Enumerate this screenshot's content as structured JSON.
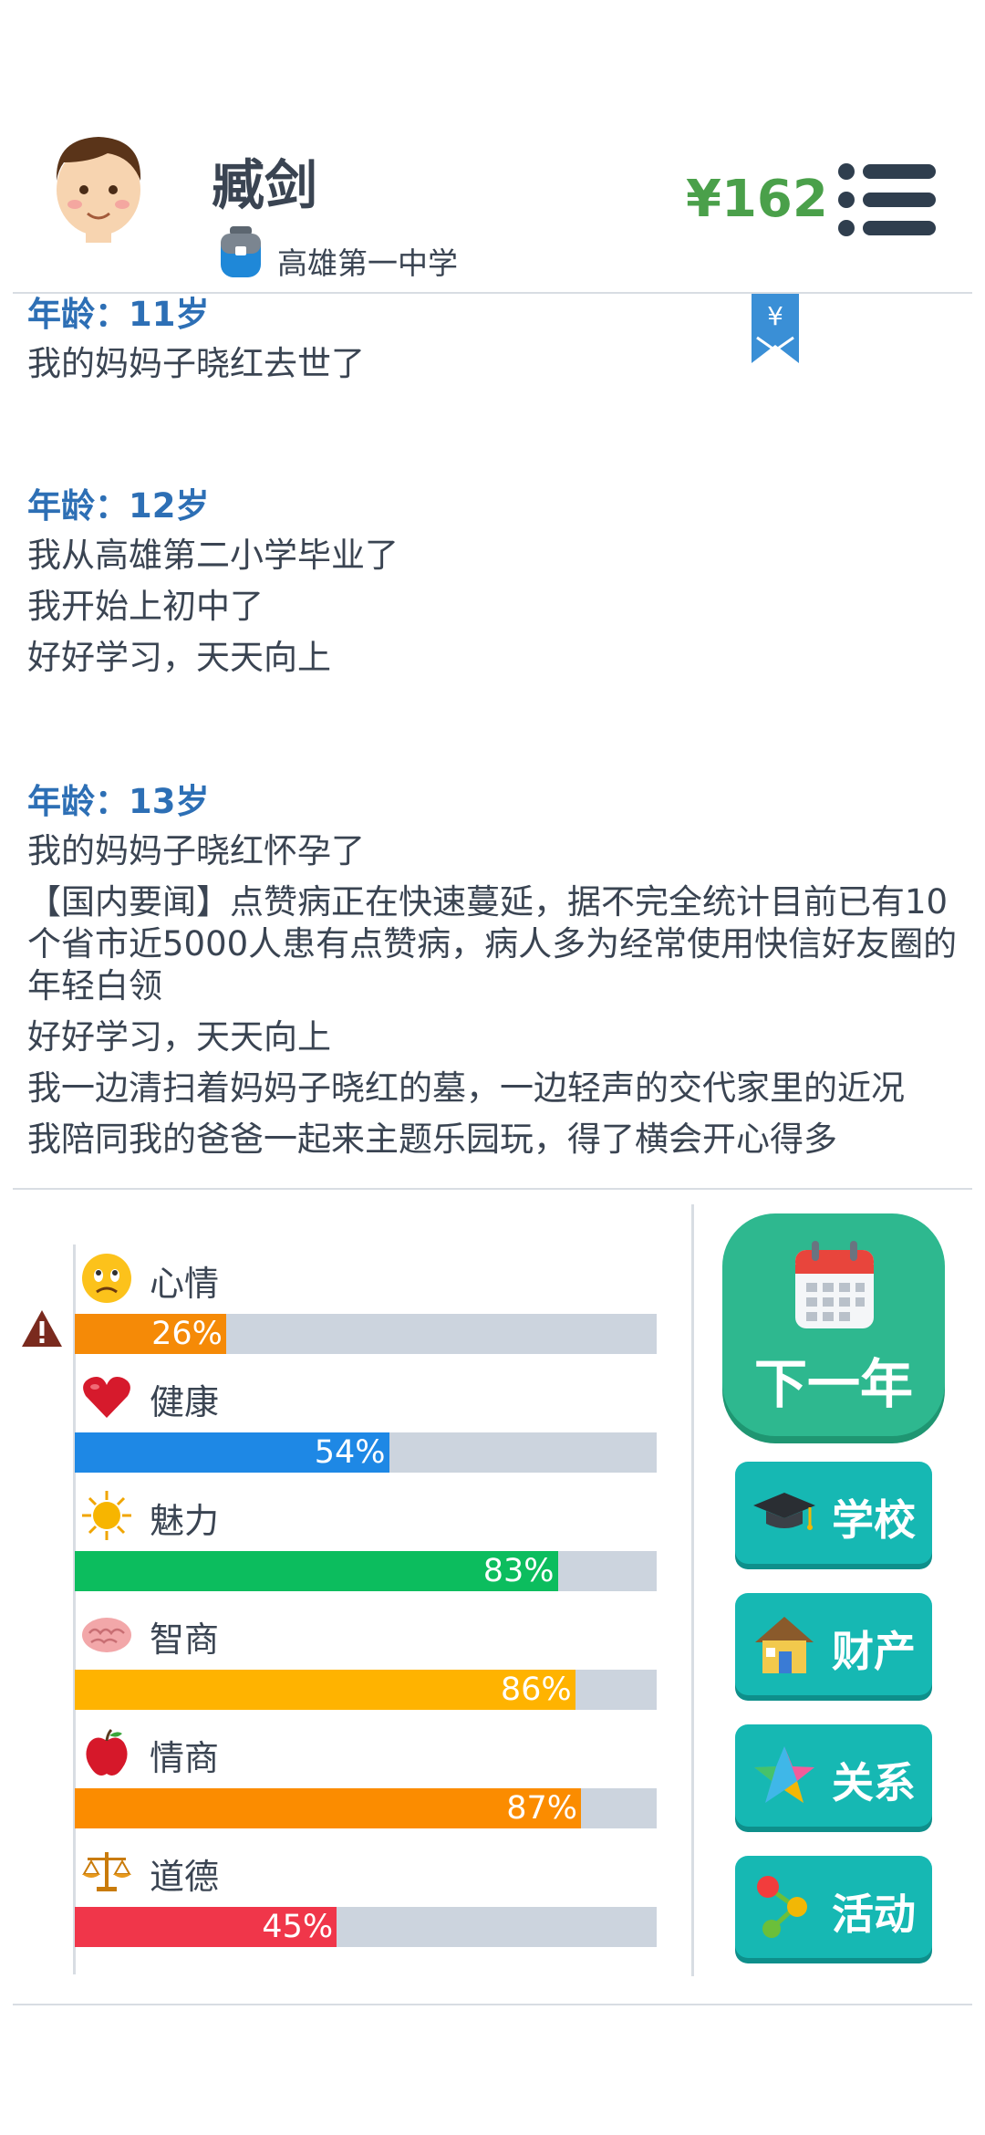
{
  "header": {
    "name": "臧剑",
    "school": "高雄第一中学",
    "money": "¥162",
    "bookmark_symbol": "¥"
  },
  "log": [
    {
      "age": "年龄：11岁",
      "lines": [
        "我的妈妈子晓红去世了"
      ]
    },
    {
      "age": "年龄：12岁",
      "lines": [
        "我从高雄第二小学毕业了",
        "我开始上初中了",
        "好好学习，天天向上"
      ]
    },
    {
      "age": "年龄：13岁",
      "lines": [
        "我的妈妈子晓红怀孕了",
        "【国内要闻】点赞病正在快速蔓延，据不完全统计目前已有10个省市近5000人患有点赞病，病人多为经常使用快信好友圈的年轻白领",
        "好好学习，天天向上",
        "我一边清扫着妈妈子晓红的墓，一边轻声的交代家里的近况",
        "我陪同我的爸爸一起来主题乐园玩，得了横会开心得多"
      ]
    }
  ],
  "stats": [
    {
      "label": "心情",
      "percent": 26,
      "pct_text": "26%",
      "color": "#f58a07",
      "icon": "sad-face-icon"
    },
    {
      "label": "健康",
      "percent": 54,
      "pct_text": "54%",
      "color": "#1e88e5",
      "icon": "heart-icon"
    },
    {
      "label": "魅力",
      "percent": 83,
      "pct_text": "83%",
      "color": "#0cbd5e",
      "icon": "sun-icon"
    },
    {
      "label": "智商",
      "percent": 86,
      "pct_text": "86%",
      "color": "#ffb300",
      "icon": "brain-icon"
    },
    {
      "label": "情商",
      "percent": 87,
      "pct_text": "87%",
      "color": "#fb8c00",
      "icon": "apple-icon"
    },
    {
      "label": "道德",
      "percent": 45,
      "pct_text": "45%",
      "color": "#f0364a",
      "icon": "scales-icon"
    }
  ],
  "buttons": {
    "next_year": "下一年",
    "school": "学校",
    "property": "财产",
    "relations": "关系",
    "activity": "活动"
  },
  "colors": {
    "money": "#4aa04a",
    "age_heading": "#2d6fb5",
    "next_year_bg": "#2eb88f",
    "side_btn_bg": "#16b8b3",
    "bar_track": "#ccd4de"
  }
}
